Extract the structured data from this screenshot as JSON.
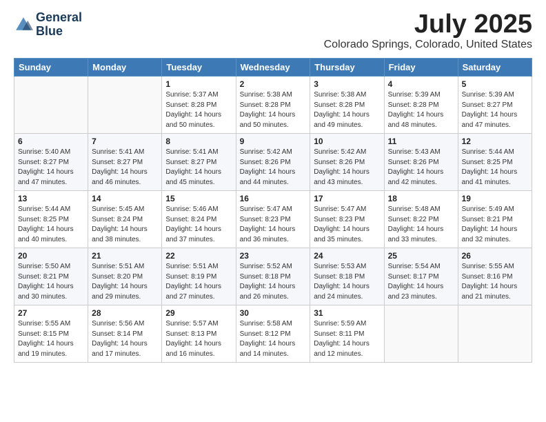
{
  "header": {
    "logo_line1": "General",
    "logo_line2": "Blue",
    "month": "July 2025",
    "location": "Colorado Springs, Colorado, United States"
  },
  "weekdays": [
    "Sunday",
    "Monday",
    "Tuesday",
    "Wednesday",
    "Thursday",
    "Friday",
    "Saturday"
  ],
  "weeks": [
    [
      {
        "day": "",
        "info": ""
      },
      {
        "day": "",
        "info": ""
      },
      {
        "day": "1",
        "info": "Sunrise: 5:37 AM\nSunset: 8:28 PM\nDaylight: 14 hours and 50 minutes."
      },
      {
        "day": "2",
        "info": "Sunrise: 5:38 AM\nSunset: 8:28 PM\nDaylight: 14 hours and 50 minutes."
      },
      {
        "day": "3",
        "info": "Sunrise: 5:38 AM\nSunset: 8:28 PM\nDaylight: 14 hours and 49 minutes."
      },
      {
        "day": "4",
        "info": "Sunrise: 5:39 AM\nSunset: 8:28 PM\nDaylight: 14 hours and 48 minutes."
      },
      {
        "day": "5",
        "info": "Sunrise: 5:39 AM\nSunset: 8:27 PM\nDaylight: 14 hours and 47 minutes."
      }
    ],
    [
      {
        "day": "6",
        "info": "Sunrise: 5:40 AM\nSunset: 8:27 PM\nDaylight: 14 hours and 47 minutes."
      },
      {
        "day": "7",
        "info": "Sunrise: 5:41 AM\nSunset: 8:27 PM\nDaylight: 14 hours and 46 minutes."
      },
      {
        "day": "8",
        "info": "Sunrise: 5:41 AM\nSunset: 8:27 PM\nDaylight: 14 hours and 45 minutes."
      },
      {
        "day": "9",
        "info": "Sunrise: 5:42 AM\nSunset: 8:26 PM\nDaylight: 14 hours and 44 minutes."
      },
      {
        "day": "10",
        "info": "Sunrise: 5:42 AM\nSunset: 8:26 PM\nDaylight: 14 hours and 43 minutes."
      },
      {
        "day": "11",
        "info": "Sunrise: 5:43 AM\nSunset: 8:26 PM\nDaylight: 14 hours and 42 minutes."
      },
      {
        "day": "12",
        "info": "Sunrise: 5:44 AM\nSunset: 8:25 PM\nDaylight: 14 hours and 41 minutes."
      }
    ],
    [
      {
        "day": "13",
        "info": "Sunrise: 5:44 AM\nSunset: 8:25 PM\nDaylight: 14 hours and 40 minutes."
      },
      {
        "day": "14",
        "info": "Sunrise: 5:45 AM\nSunset: 8:24 PM\nDaylight: 14 hours and 38 minutes."
      },
      {
        "day": "15",
        "info": "Sunrise: 5:46 AM\nSunset: 8:24 PM\nDaylight: 14 hours and 37 minutes."
      },
      {
        "day": "16",
        "info": "Sunrise: 5:47 AM\nSunset: 8:23 PM\nDaylight: 14 hours and 36 minutes."
      },
      {
        "day": "17",
        "info": "Sunrise: 5:47 AM\nSunset: 8:23 PM\nDaylight: 14 hours and 35 minutes."
      },
      {
        "day": "18",
        "info": "Sunrise: 5:48 AM\nSunset: 8:22 PM\nDaylight: 14 hours and 33 minutes."
      },
      {
        "day": "19",
        "info": "Sunrise: 5:49 AM\nSunset: 8:21 PM\nDaylight: 14 hours and 32 minutes."
      }
    ],
    [
      {
        "day": "20",
        "info": "Sunrise: 5:50 AM\nSunset: 8:21 PM\nDaylight: 14 hours and 30 minutes."
      },
      {
        "day": "21",
        "info": "Sunrise: 5:51 AM\nSunset: 8:20 PM\nDaylight: 14 hours and 29 minutes."
      },
      {
        "day": "22",
        "info": "Sunrise: 5:51 AM\nSunset: 8:19 PM\nDaylight: 14 hours and 27 minutes."
      },
      {
        "day": "23",
        "info": "Sunrise: 5:52 AM\nSunset: 8:18 PM\nDaylight: 14 hours and 26 minutes."
      },
      {
        "day": "24",
        "info": "Sunrise: 5:53 AM\nSunset: 8:18 PM\nDaylight: 14 hours and 24 minutes."
      },
      {
        "day": "25",
        "info": "Sunrise: 5:54 AM\nSunset: 8:17 PM\nDaylight: 14 hours and 23 minutes."
      },
      {
        "day": "26",
        "info": "Sunrise: 5:55 AM\nSunset: 8:16 PM\nDaylight: 14 hours and 21 minutes."
      }
    ],
    [
      {
        "day": "27",
        "info": "Sunrise: 5:55 AM\nSunset: 8:15 PM\nDaylight: 14 hours and 19 minutes."
      },
      {
        "day": "28",
        "info": "Sunrise: 5:56 AM\nSunset: 8:14 PM\nDaylight: 14 hours and 17 minutes."
      },
      {
        "day": "29",
        "info": "Sunrise: 5:57 AM\nSunset: 8:13 PM\nDaylight: 14 hours and 16 minutes."
      },
      {
        "day": "30",
        "info": "Sunrise: 5:58 AM\nSunset: 8:12 PM\nDaylight: 14 hours and 14 minutes."
      },
      {
        "day": "31",
        "info": "Sunrise: 5:59 AM\nSunset: 8:11 PM\nDaylight: 14 hours and 12 minutes."
      },
      {
        "day": "",
        "info": ""
      },
      {
        "day": "",
        "info": ""
      }
    ]
  ]
}
